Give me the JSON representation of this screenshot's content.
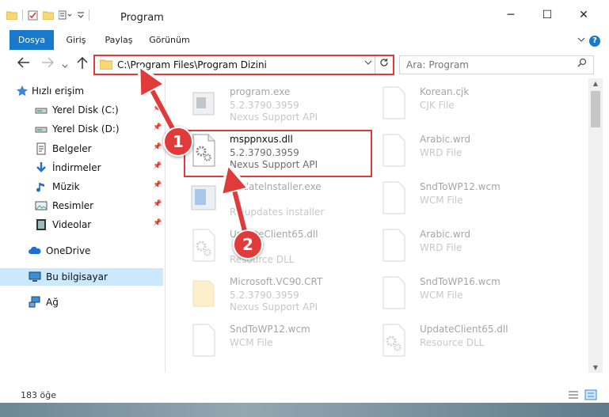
{
  "window": {
    "title": "Program",
    "controls": {
      "minimize": "─",
      "maximize": "☐",
      "close": "✕"
    }
  },
  "ribbon": {
    "tabs": [
      {
        "label": "Dosya",
        "active": true
      },
      {
        "label": "Giriş",
        "active": false
      },
      {
        "label": "Paylaş",
        "active": false
      },
      {
        "label": "Görünüm",
        "active": false
      }
    ],
    "help": "?"
  },
  "navigation": {
    "address": "C:\\Program Files\\Program Dizini",
    "search_placeholder": "Ara: Program"
  },
  "sidebar": {
    "items": [
      {
        "label": "Hızlı erişim",
        "icon": "star-icon",
        "pinned": false
      },
      {
        "label": "Yerel Disk (C:)",
        "icon": "drive-icon",
        "pinned": true
      },
      {
        "label": "Yerel Disk (D:)",
        "icon": "drive-icon",
        "pinned": true
      },
      {
        "label": "Belgeler",
        "icon": "documents-icon",
        "pinned": true
      },
      {
        "label": "İndirmeler",
        "icon": "download-icon",
        "pinned": true
      },
      {
        "label": "Müzik",
        "icon": "music-icon",
        "pinned": true
      },
      {
        "label": "Resimler",
        "icon": "pictures-icon",
        "pinned": true
      },
      {
        "label": "Videolar",
        "icon": "videos-icon",
        "pinned": true
      },
      {
        "label": "OneDrive",
        "icon": "cloud-icon",
        "pinned": false
      },
      {
        "label": "Bu bilgisayar",
        "icon": "computer-icon",
        "pinned": false,
        "selected": true
      },
      {
        "label": "Ağ",
        "icon": "network-icon",
        "pinned": false
      }
    ]
  },
  "files": {
    "left": [
      {
        "name": "program.exe",
        "line1": "5.2.3790.3959",
        "line2": "Nexus Support API",
        "icon": "exe-icon",
        "faded": true
      },
      {
        "name": "msppnxus.dll",
        "line1": "5.2.3790.3959",
        "line2": "Nexus Support API",
        "icon": "dll-gear-icon",
        "faded": false
      },
      {
        "name": "Updatelnstaller.exe",
        "line1": "",
        "line2": "RY updates installer",
        "icon": "installer-icon",
        "faded": true
      },
      {
        "name": "UpdateClient65.dll",
        "line1": "",
        "line2": "Resource DLL",
        "icon": "dll-gear-icon",
        "faded": true
      },
      {
        "name": "Microsoft.VC90.CRT",
        "line1": "5.2.3790.3959",
        "line2": "Nexus Support API",
        "icon": "folder-icon",
        "faded": true
      },
      {
        "name": "SndToWP12.wcm",
        "line1": "WCM File",
        "line2": "",
        "icon": "file-icon",
        "faded": true
      }
    ],
    "right": [
      {
        "name": "Korean.cjk",
        "line1": "CJK File",
        "line2": "",
        "icon": "file-icon",
        "faded": true
      },
      {
        "name": "Arabic.wrd",
        "line1": "WRD File",
        "line2": "",
        "icon": "file-icon",
        "faded": true
      },
      {
        "name": "SndToWP12.wcm",
        "line1": "WCM File",
        "line2": "",
        "icon": "file-icon",
        "faded": true
      },
      {
        "name": "Arabic.wrd",
        "line1": "WRD File",
        "line2": "",
        "icon": "file-icon",
        "faded": true
      },
      {
        "name": "SndToWP16.wcm",
        "line1": "WCM File",
        "line2": "",
        "icon": "file-icon",
        "faded": true
      },
      {
        "name": "UpdateClient65.dll",
        "line1": "Resource DLL",
        "line2": "",
        "icon": "dll-gear-icon",
        "faded": true
      }
    ]
  },
  "status": {
    "item_count": "183 öğe"
  },
  "annotations": {
    "badge1": "1",
    "badge2": "2"
  },
  "colors": {
    "accent": "#1979ca",
    "highlight": "#e03a3a",
    "selected": "#cce8ff"
  }
}
